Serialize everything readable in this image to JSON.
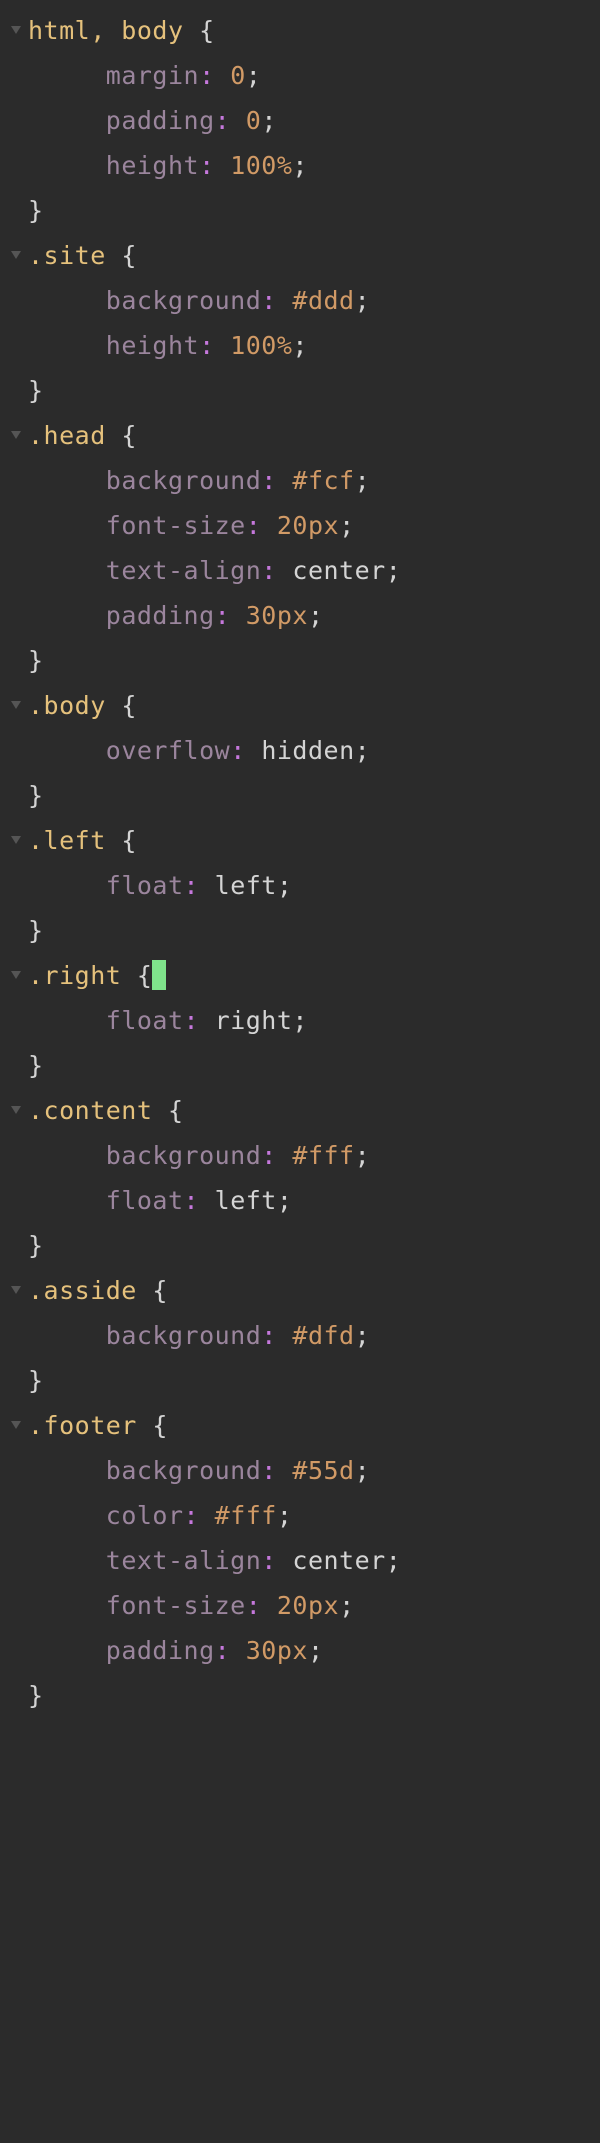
{
  "language": "css",
  "theme": "dark",
  "cursor_line_index": 26,
  "rules": [
    {
      "selector": "html, body",
      "foldable": true,
      "declarations": [
        {
          "property": "margin",
          "value": "0",
          "value_type": "num"
        },
        {
          "property": "padding",
          "value": "0",
          "value_type": "num"
        },
        {
          "property": "height",
          "value": "100%",
          "value_type": "num"
        }
      ]
    },
    {
      "selector": ".site",
      "foldable": true,
      "declarations": [
        {
          "property": "background",
          "value": "#ddd",
          "value_type": "hex"
        },
        {
          "property": "height",
          "value": "100%",
          "value_type": "num"
        }
      ]
    },
    {
      "selector": ".head",
      "foldable": true,
      "declarations": [
        {
          "property": "background",
          "value": "#fcf",
          "value_type": "hex"
        },
        {
          "property": "font-size",
          "value": "20px",
          "value_type": "num"
        },
        {
          "property": "text-align",
          "value": "center",
          "value_type": "val"
        },
        {
          "property": "padding",
          "value": "30px",
          "value_type": "num"
        }
      ]
    },
    {
      "selector": ".body",
      "foldable": true,
      "declarations": [
        {
          "property": "overflow",
          "value": "hidden",
          "value_type": "val"
        }
      ]
    },
    {
      "selector": ".left",
      "foldable": true,
      "declarations": [
        {
          "property": "float",
          "value": "left",
          "value_type": "val"
        }
      ]
    },
    {
      "selector": ".right",
      "foldable": true,
      "cursor_after_brace": true,
      "declarations": [
        {
          "property": "float",
          "value": "right",
          "value_type": "val"
        }
      ]
    },
    {
      "selector": ".content",
      "foldable": true,
      "declarations": [
        {
          "property": "background",
          "value": "#fff",
          "value_type": "hex"
        },
        {
          "property": "float",
          "value": "left",
          "value_type": "val"
        }
      ]
    },
    {
      "selector": ".asside",
      "foldable": true,
      "declarations": [
        {
          "property": "background",
          "value": "#dfd",
          "value_type": "hex"
        }
      ]
    },
    {
      "selector": ".footer",
      "foldable": true,
      "declarations": [
        {
          "property": "background",
          "value": "#55d",
          "value_type": "hex"
        },
        {
          "property": "color",
          "value": "#fff",
          "value_type": "hex"
        },
        {
          "property": "text-align",
          "value": "center",
          "value_type": "val"
        },
        {
          "property": "font-size",
          "value": "20px",
          "value_type": "num"
        },
        {
          "property": "padding",
          "value": "30px",
          "value_type": "num"
        }
      ]
    }
  ],
  "glyphs": {
    "open_brace": "{",
    "close_brace": "}",
    "colon": ":",
    "semicolon": ";",
    "space": " "
  }
}
